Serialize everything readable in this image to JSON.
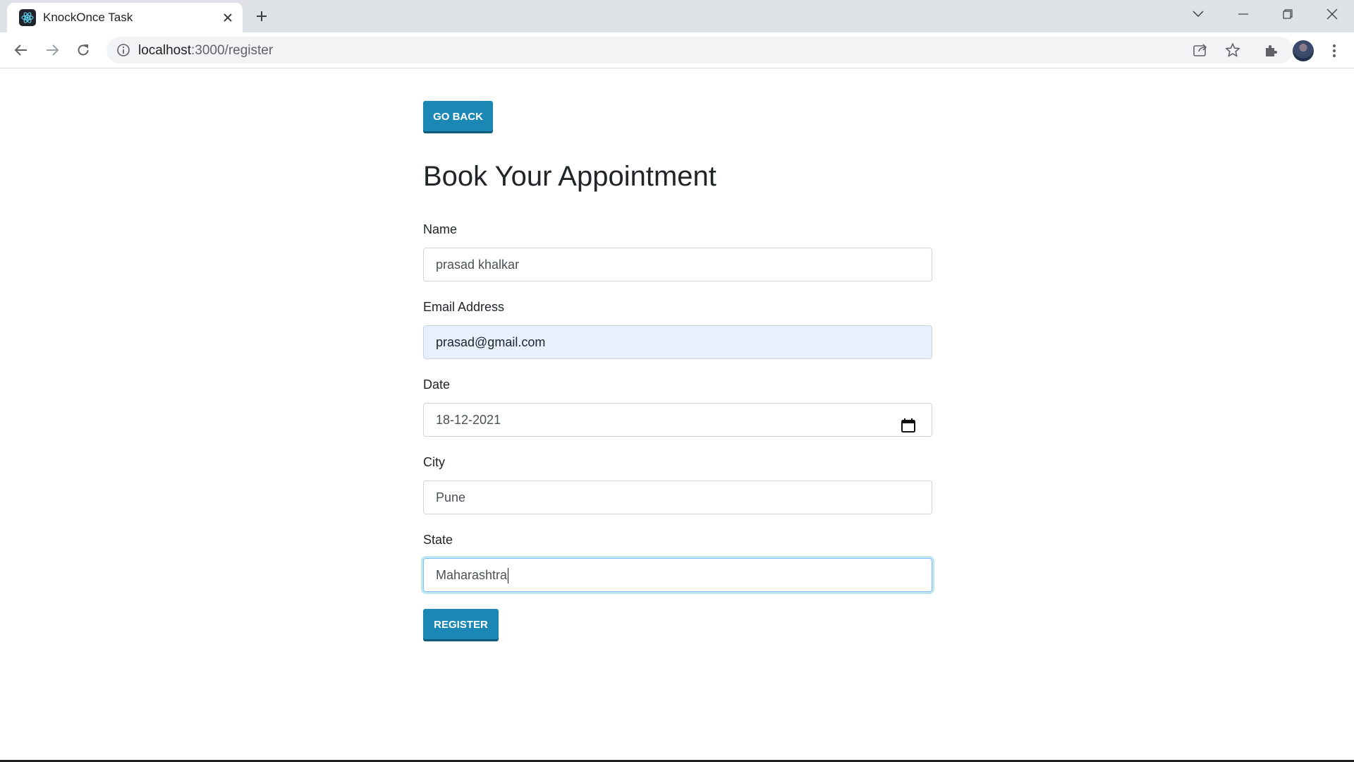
{
  "browser": {
    "tab_title": "KnockOnce Task",
    "url_host": "localhost",
    "url_path": ":3000/register"
  },
  "icons": {
    "favicon": "react-logo-icon",
    "tab_close": "close-icon",
    "new_tab": "plus-icon",
    "tab_search": "chevron-down-icon",
    "minimize": "minimize-icon",
    "restore": "restore-icon",
    "close_window": "close-icon",
    "back": "arrow-left-icon",
    "forward": "arrow-right-icon",
    "reload": "reload-icon",
    "site_info": "info-icon",
    "share": "share-icon",
    "bookmark": "star-icon",
    "extensions": "puzzle-icon",
    "menu": "kebab-menu-icon",
    "calendar": "calendar-icon"
  },
  "page": {
    "go_back_label": "GO BACK",
    "title": "Book Your Appointment",
    "register_label": "REGISTER"
  },
  "form": {
    "name": {
      "label": "Name",
      "value": "prasad khalkar"
    },
    "email": {
      "label": "Email Address",
      "value": "prasad@gmail.com"
    },
    "date": {
      "label": "Date",
      "value": "18-12-2021"
    },
    "city": {
      "label": "City",
      "value": "Pune"
    },
    "state": {
      "label": "State",
      "value": "Maharashtra"
    }
  },
  "colors": {
    "primary_button": "#1a87b4",
    "autofill_bg": "#e8f0fe",
    "focus_ring": "#bfe8ee"
  }
}
